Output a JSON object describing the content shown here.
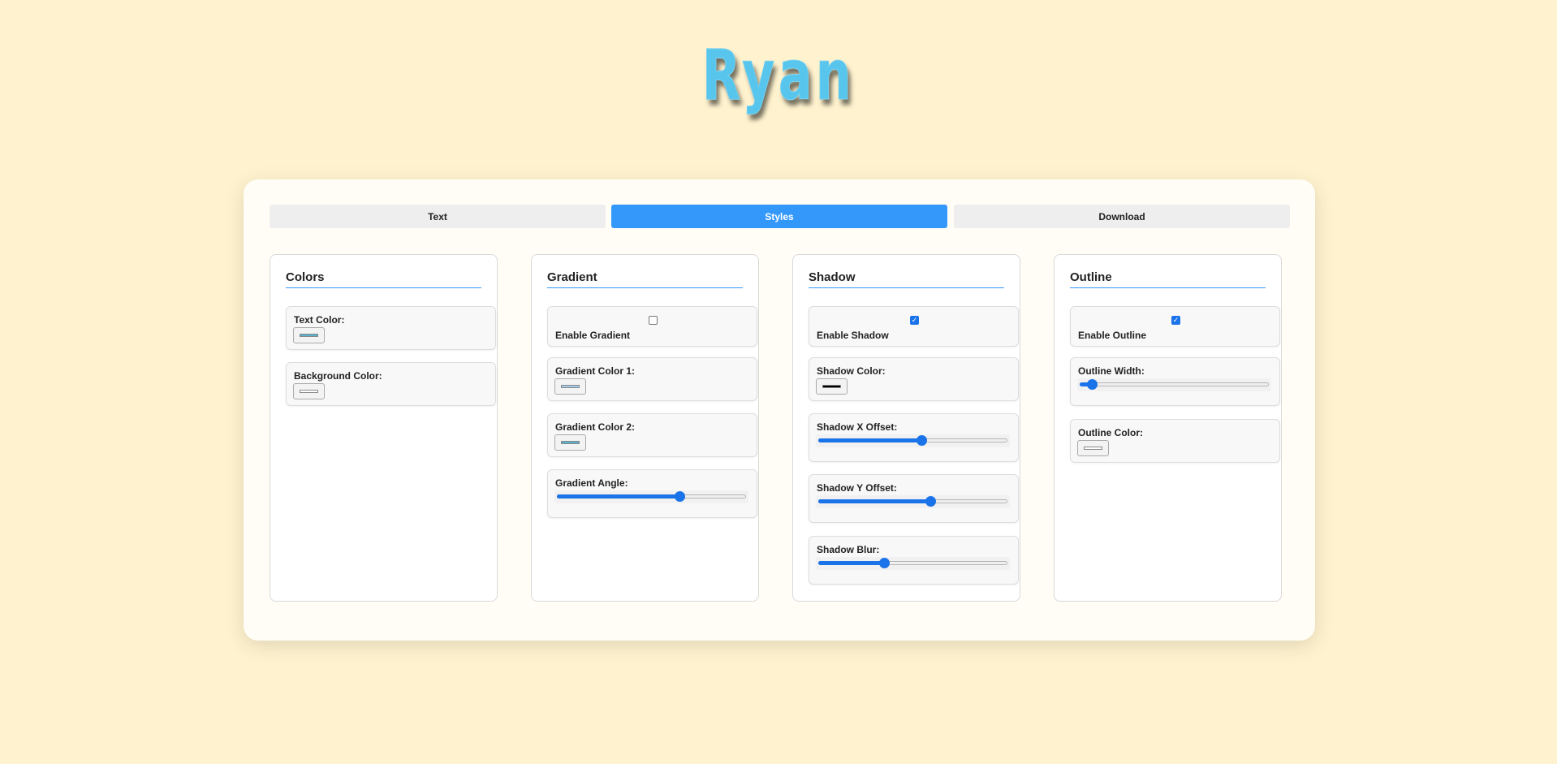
{
  "title": "Ryan",
  "colors": {
    "title_fill": "#57c5ec",
    "background": "#fff3cf",
    "accent": "#3498fb",
    "slider": "#1a73e8"
  },
  "tabs": [
    {
      "label": "Text",
      "active": false
    },
    {
      "label": "Styles",
      "active": true
    },
    {
      "label": "Download",
      "active": false
    }
  ],
  "panels": {
    "colors": {
      "title": "Colors",
      "text_color": {
        "label": "Text Color:",
        "value": "#5ab0cc"
      },
      "background_color": {
        "label": "Background Color:",
        "value": "#ffffff"
      }
    },
    "gradient": {
      "title": "Gradient",
      "enable": {
        "label": "Enable Gradient",
        "checked": false
      },
      "color1": {
        "label": "Gradient Color 1:",
        "value": "#a3cbea"
      },
      "color2": {
        "label": "Gradient Color 2:",
        "value": "#5ab0cc"
      },
      "angle": {
        "label": "Gradient Angle:",
        "value_fraction": 0.66
      }
    },
    "shadow": {
      "title": "Shadow",
      "enable": {
        "label": "Enable Shadow",
        "checked": true
      },
      "color": {
        "label": "Shadow Color:",
        "value": "#000000"
      },
      "x_offset": {
        "label": "Shadow X Offset:",
        "value_fraction": 0.55
      },
      "y_offset": {
        "label": "Shadow Y Offset:",
        "value_fraction": 0.6
      },
      "blur": {
        "label": "Shadow Blur:",
        "value_fraction": 0.34
      }
    },
    "outline": {
      "title": "Outline",
      "enable": {
        "label": "Enable Outline",
        "checked": true
      },
      "width": {
        "label": "Outline Width:",
        "value_fraction": 0.04
      },
      "color": {
        "label": "Outline Color:",
        "value": "#ffffff"
      }
    }
  }
}
